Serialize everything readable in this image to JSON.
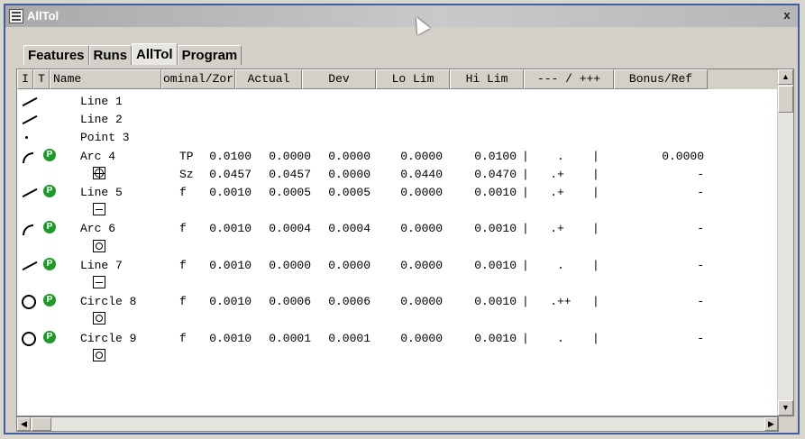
{
  "window": {
    "title": "AllTol",
    "close_label": "x"
  },
  "tabs": [
    {
      "label": "Features"
    },
    {
      "label": "Runs"
    },
    {
      "label": "AllTol"
    },
    {
      "label": "Program"
    }
  ],
  "columns": {
    "i": "I",
    "t": "T",
    "name": "Name",
    "nominal": "ominal/Zor",
    "actual": "Actual",
    "dev": "Dev",
    "lo": "Lo Lim",
    "hi": "Hi Lim",
    "bar": "--- / +++",
    "bonus": "Bonus/Ref"
  },
  "rows": [
    {
      "icon": "line-icon",
      "p": "",
      "name": "Line 1"
    },
    {
      "icon": "line-icon",
      "p": "",
      "name": "Line 2"
    },
    {
      "icon": "point-icon",
      "p": "",
      "name": "Point 3"
    },
    {
      "icon": "arc-icon",
      "p": "P",
      "name": "Arc 4",
      "nom_prefix": "TP",
      "nominal": "0.0100",
      "actual": "0.0000",
      "dev": "0.0000",
      "lo": "0.0000",
      "hi": "0.0100",
      "bar": "|    .    |",
      "bonus": "0.0000"
    },
    {
      "icon": "position-symbol-icon",
      "p": "",
      "name": "",
      "nom_prefix": "Sz",
      "nominal": "0.0457",
      "actual": "0.0457",
      "dev": "0.0000",
      "lo": "0.0440",
      "hi": "0.0470",
      "bar": "|   .+    |",
      "bonus": "-"
    },
    {
      "icon": "line-icon",
      "p": "P",
      "name": "Line 5",
      "nom_prefix": "f",
      "nominal": "0.0010",
      "actual": "0.0005",
      "dev": "0.0005",
      "lo": "0.0000",
      "hi": "0.0010",
      "bar": "|   .+    |",
      "bonus": "-"
    },
    {
      "icon": "flatness-symbol-icon",
      "p": "",
      "name": ""
    },
    {
      "icon": "arc-icon",
      "p": "P",
      "name": "Arc 6",
      "nom_prefix": "f",
      "nominal": "0.0010",
      "actual": "0.0004",
      "dev": "0.0004",
      "lo": "0.0000",
      "hi": "0.0010",
      "bar": "|   .+    |",
      "bonus": "-"
    },
    {
      "icon": "circularity-symbol-icon",
      "p": "",
      "name": ""
    },
    {
      "icon": "line-icon",
      "p": "P",
      "name": "Line 7",
      "nom_prefix": "f",
      "nominal": "0.0010",
      "actual": "0.0000",
      "dev": "0.0000",
      "lo": "0.0000",
      "hi": "0.0010",
      "bar": "|    .    |",
      "bonus": "-"
    },
    {
      "icon": "flatness-symbol-icon",
      "p": "",
      "name": ""
    },
    {
      "icon": "circle-icon",
      "p": "P",
      "name": "Circle 8",
      "nom_prefix": "f",
      "nominal": "0.0010",
      "actual": "0.0006",
      "dev": "0.0006",
      "lo": "0.0000",
      "hi": "0.0010",
      "bar": "|   .++   |",
      "bonus": "-"
    },
    {
      "icon": "circularity-symbol-icon",
      "p": "",
      "name": ""
    },
    {
      "icon": "circle-icon",
      "p": "P",
      "name": "Circle 9",
      "nom_prefix": "f",
      "nominal": "0.0010",
      "actual": "0.0001",
      "dev": "0.0001",
      "lo": "0.0000",
      "hi": "0.0010",
      "bar": "|    .    |",
      "bonus": "-"
    },
    {
      "icon": "circularity-symbol-icon",
      "p": "",
      "name": ""
    }
  ],
  "colors": {
    "badge_green": "#1f9a2a",
    "window_border": "#3f5fa0"
  }
}
